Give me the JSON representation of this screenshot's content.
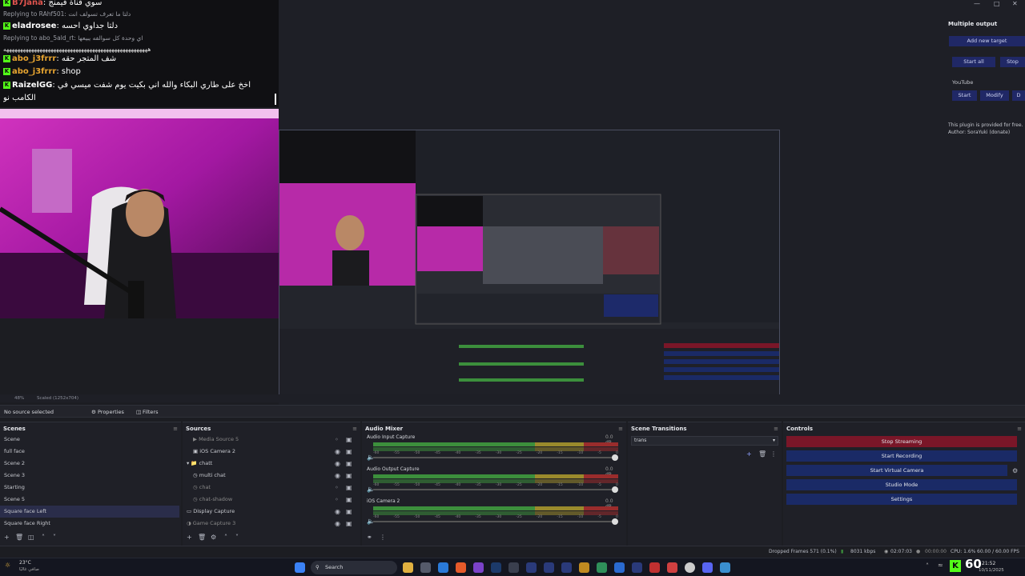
{
  "chat": {
    "lines": [
      {
        "type": "msg",
        "name": "B7Jana",
        "name_color": "#e0544e",
        "text": "سوي قناة قيمنج"
      },
      {
        "type": "reply",
        "text": "Replying to  RAhf501: دلتا ما تعرف تسولف انت"
      },
      {
        "type": "msg",
        "name": "eladrosee",
        "name_color": "#ffffff",
        "text": "دلتا جداوي احسه"
      },
      {
        "type": "reply",
        "text": "Replying to  abo_5ald_rt: اي وحدة كل سوالفه يبيعها"
      },
      {
        "type": "reply",
        "text": "ههههههههههههههههههههههههههههههههههههههههههههههههههههه"
      },
      {
        "type": "msg",
        "name": "abo_j3frrr",
        "name_color": "#e8a530",
        "text": "شف المتجر حقه"
      },
      {
        "type": "msg",
        "name": "abo_j3frrr",
        "name_color": "#e8a530",
        "text": "shop"
      },
      {
        "type": "msg",
        "name": "RaizelGG",
        "name_color": "#ffffff",
        "text": "اخخ على طاري البكاء والله اني بكيت يوم شفت ميسي في"
      },
      {
        "type": "cont",
        "text": "الكامب نو"
      }
    ]
  },
  "preview_bar": {
    "zoom": "48%",
    "scaled": "Scaled (1252x704)"
  },
  "source_bar": {
    "no_source": "No source selected",
    "properties": "Properties",
    "filters": "Filters"
  },
  "scenes": {
    "title": "Scenes",
    "items": [
      "Scene",
      "full face",
      "Scene 2",
      "Scene 3",
      "Starting",
      "Scene 5",
      "Square face Left",
      "Square face Right"
    ],
    "selected": "Square face Left"
  },
  "sources": {
    "title": "Sources",
    "items": [
      "Media Source 5",
      "iOS Camera 2",
      "chatt",
      "multi chat",
      "chat",
      "chat-shadow",
      "Display Capture",
      "Game Capture 3"
    ]
  },
  "mixer": {
    "title": "Audio Mixer",
    "channels": [
      {
        "name": "Audio Input Capture",
        "db": "0.0 dB"
      },
      {
        "name": "Audio Output Capture",
        "db": "0.0 dB"
      },
      {
        "name": "iOS Camera 2",
        "db": "0.0 dB"
      }
    ],
    "ticks": [
      "-60",
      "-55",
      "-50",
      "-45",
      "-40",
      "-35",
      "-30",
      "-25",
      "-20",
      "-15",
      "-10",
      "-5",
      "0"
    ]
  },
  "transitions": {
    "title": "Scene Transitions",
    "selected": "trans"
  },
  "controls": {
    "title": "Controls",
    "stop_streaming": "Stop Streaming",
    "start_recording": "Start Recording",
    "start_virtual_camera": "Start Virtual Camera",
    "studio_mode": "Studio Mode",
    "settings": "Settings"
  },
  "multi_output": {
    "title": "Multiple output",
    "add_target": "Add new target",
    "start_all": "Start all",
    "stop_all": "Stop",
    "target_name": "YouTube",
    "start": "Start",
    "modify": "Modify",
    "delete": "D",
    "plugin_note": "This plugin is provided for free.",
    "author": "Author: SoraYuki (donate)"
  },
  "status": {
    "dropped": "Dropped Frames 571 (0.1%)",
    "kbps": "8031 kbps",
    "live_time": "02:07:03",
    "rec_time": "00:00:00",
    "cpu": "CPU: 1.6%",
    "fps": "60.00 / 60.00 FPS"
  },
  "taskbar": {
    "weather": "23°C",
    "weather_desc": "صافي غالبًا",
    "search": "Search",
    "kick_count": "60",
    "time": "21:52",
    "date": "10/11/2025"
  },
  "colors": {
    "accent": "#53fc18",
    "stop": "#7a1628",
    "button": "#1a2a66",
    "bg": "#1e1f26"
  }
}
